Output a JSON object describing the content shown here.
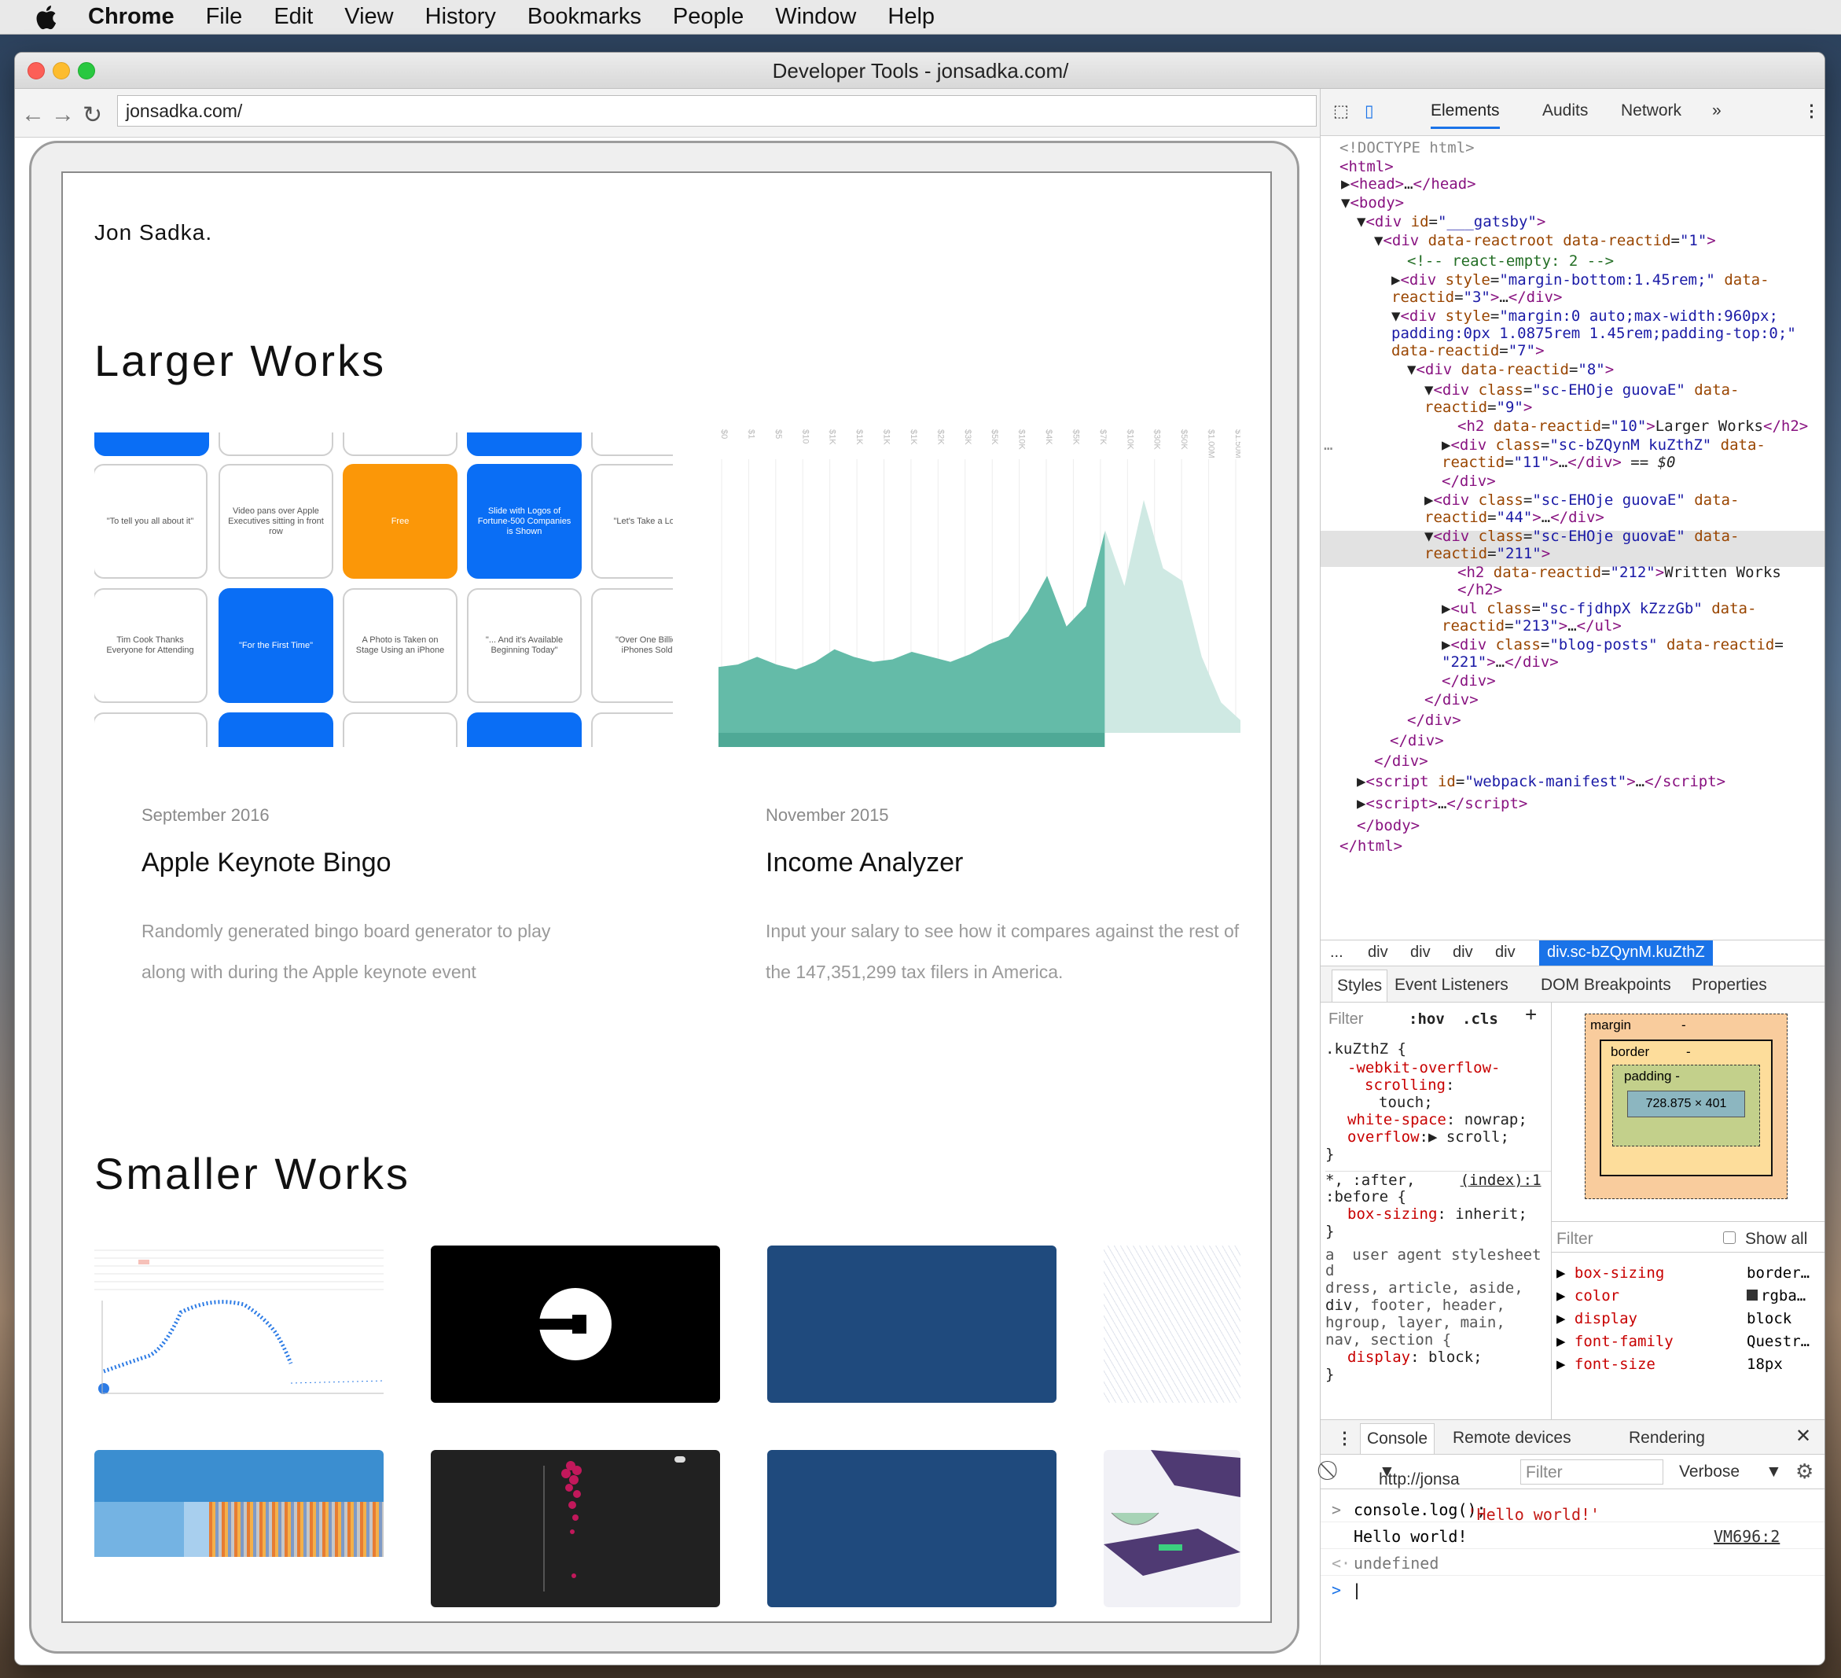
{
  "menubar": {
    "app": "Chrome",
    "items": [
      "File",
      "Edit",
      "View",
      "History",
      "Bookmarks",
      "People",
      "Window",
      "Help"
    ]
  },
  "window": {
    "title": "Developer Tools - jonsadka.com/"
  },
  "browser": {
    "url": "jonsadka.com/"
  },
  "site": {
    "brand": "Jon Sadka.",
    "larger_heading": "Larger Works",
    "smaller_heading": "Smaller Works",
    "bingo": {
      "tiles": [
        "\"To tell you all about it\"",
        "Video pans over Apple Executives sitting in front row",
        "Free",
        "Slide with Logos of Fortune-500 Companies is Shown",
        "\"Let's Take a Look",
        "Tim Cook Thanks Everyone for Attending",
        "\"For the First Time\"",
        "A Photo is Taken on Stage Using an iPhone",
        "\"... And it's Available Beginning Today\"",
        "\"Over One Billion iPhones Sold\""
      ]
    },
    "projects": [
      {
        "date": "September 2016",
        "title": "Apple Keynote Bingo",
        "desc": "Randomly generated bingo board generator to play along with during the Apple keynote event"
      },
      {
        "date": "November 2015",
        "title": "Income Analyzer",
        "desc": "Input your salary to see how it compares against the rest of the 147,351,299 tax filers in America."
      }
    ],
    "income_axis": [
      "$0",
      "$1",
      "$5",
      "$10",
      "$1K",
      "$1K",
      "$1K",
      "$1K",
      "$2K",
      "$3K",
      "$5K",
      "$10K",
      "$4K",
      "$5K",
      "$7K",
      "$10K",
      "$30K",
      "$50K",
      "$1.00M",
      "$1.50M"
    ],
    "income_chart": {
      "type": "area",
      "points": [
        0.26,
        0.27,
        0.3,
        0.27,
        0.25,
        0.28,
        0.33,
        0.3,
        0.28,
        0.29,
        0.32,
        0.3,
        0.28,
        0.31,
        0.35,
        0.38,
        0.48,
        0.62,
        0.42,
        0.5,
        0.8,
        0.58,
        0.92,
        0.65,
        0.6,
        0.3,
        0.12,
        0.05
      ],
      "highlight_until_fraction": 0.74
    },
    "uber_label": "Uber"
  },
  "devtools": {
    "tabs": [
      "Elements",
      "Audits",
      "Network"
    ],
    "more": "»",
    "breadcrumbs": [
      "...",
      "div",
      "div",
      "div",
      "div",
      "div.sc-bZQynM.kuZthZ"
    ],
    "subtabs": [
      "Styles",
      "Event Listeners",
      "DOM Breakpoints",
      "Properties"
    ],
    "filter_placeholder": "Filter",
    "hov": ":hov",
    "cls": ".cls",
    "box": {
      "margin": "margin",
      "border": "border",
      "padding": "padding -",
      "dash": "-",
      "size": "728.875 × 401"
    },
    "computed": {
      "filter": "Filter",
      "show_all": "Show all",
      "props": [
        [
          "box-sizing",
          "border…"
        ],
        [
          "color",
          "rgba…"
        ],
        [
          "display",
          "block"
        ],
        [
          "font-family",
          "Questr…"
        ],
        [
          "font-size",
          "18px"
        ]
      ]
    },
    "console_tabs": [
      "Console",
      "Remote devices",
      "Rendering"
    ],
    "console_context": "http://jonsa",
    "console_filter": "Filter",
    "console_level": "Verbose",
    "console": {
      "cmd": "console.log('Hello world!');",
      "out": "Hello world!",
      "src": "VM696:2",
      "ret": "undefined"
    }
  },
  "colors": {
    "accent_teal": "#64bba8",
    "blue_tile": "#0a6ef5",
    "orange_tile": "#fb9708",
    "crumb_blue": "#1a73e8"
  }
}
